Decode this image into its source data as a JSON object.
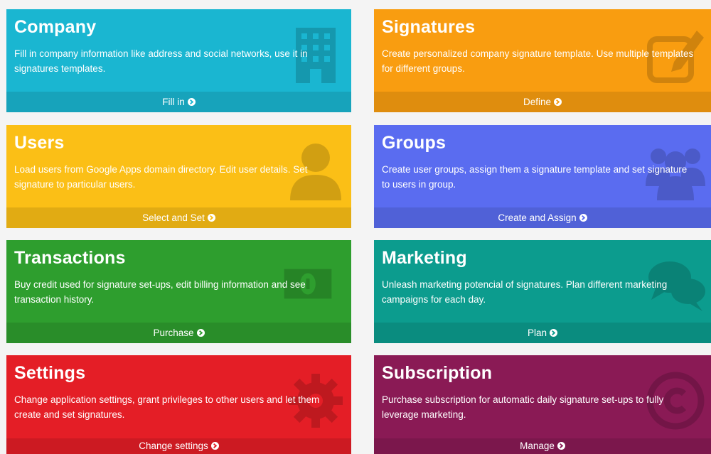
{
  "tiles": [
    {
      "title": "Company",
      "description": "Fill in company information like address and social networks, use it in signatures templates.",
      "action": "Fill in",
      "color": "#1ab6d1",
      "icon": "building-icon"
    },
    {
      "title": "Signatures",
      "description": "Create personalized company signature template. Use multiple templates for different groups.",
      "action": "Define",
      "color": "#f99d10",
      "icon": "edit-icon"
    },
    {
      "title": "Users",
      "description": "Load users from Google Apps domain directory. Edit user details. Set signature to particular users.",
      "action": "Select and Set",
      "color": "#fbbf16",
      "icon": "user-icon"
    },
    {
      "title": "Groups",
      "description": "Create user groups, assign them a signature template and set signature to users in group.",
      "action": "Create and Assign",
      "color": "#5a6cf0",
      "icon": "users-icon"
    },
    {
      "title": "Transactions",
      "description": "Buy credit used for signature set-ups, edit billing information and see transaction history.",
      "action": "Purchase",
      "color": "#2e9e2e",
      "icon": "money-icon"
    },
    {
      "title": "Marketing",
      "description": "Unleash marketing potencial of signatures. Plan different marketing campaigns for each day.",
      "action": "Plan",
      "color": "#0c9c8e",
      "icon": "comments-icon"
    },
    {
      "title": "Settings",
      "description": "Change application settings, grant privileges to other users and let them create and set signatures.",
      "action": "Change settings",
      "color": "#e41e26",
      "icon": "gear-icon"
    },
    {
      "title": "Subscription",
      "description": "Purchase subscription for automatic daily signature set-ups to fully leverage marketing.",
      "action": "Manage",
      "color": "#8a1a55",
      "icon": "copyright-icon"
    }
  ]
}
